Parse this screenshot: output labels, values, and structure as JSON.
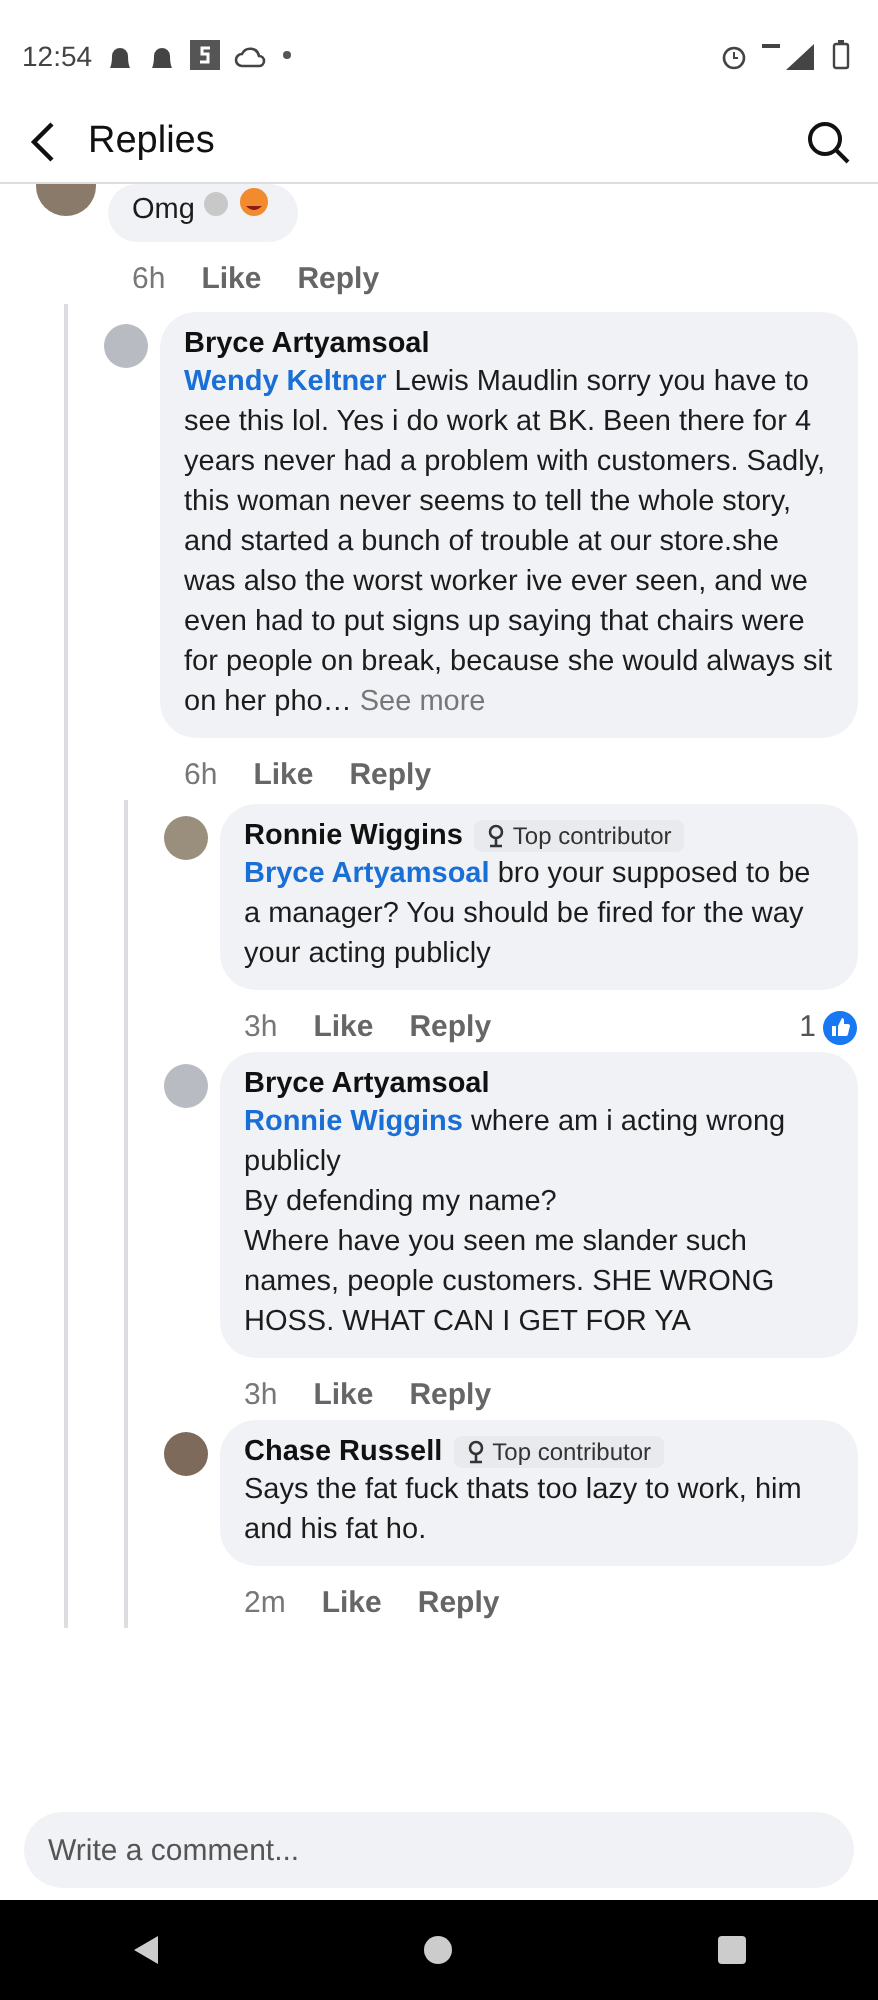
{
  "status_bar": {
    "time": "12:54"
  },
  "header": {
    "title": "Replies"
  },
  "comments": [
    {
      "text": "Omg",
      "emoji": true,
      "time": "6h",
      "actions": [
        "Like",
        "Reply"
      ],
      "children": [
        {
          "author": "Bryce Artyamsoal",
          "mention": "Wendy Keltner",
          "text": "Lewis Maudlin sorry you have to see this lol. Yes i do work at BK. Been there for 4 years never had a problem with customers. Sadly, this woman never seems to tell the whole story, and started a bunch of trouble at our store.she was also the worst worker ive ever seen, and we even had to put signs up saying that chairs were for people on break, because she would always sit on her pho…",
          "see_more": "See more",
          "time": "6h",
          "actions": [
            "Like",
            "Reply"
          ],
          "children": [
            {
              "author": "Ronnie Wiggins",
              "badge": "Top contributor",
              "mention": "Bryce Artyamsoal",
              "text": "bro your supposed to be a manager? You should be fired for the way your acting publicly",
              "time": "3h",
              "actions": [
                "Like",
                "Reply"
              ],
              "reactions": "1"
            },
            {
              "author": "Bryce Artyamsoal",
              "mention": "Ronnie Wiggins",
              "text": "where am i acting wrong publicly\nBy defending my name?\nWhere have you seen me slander such names, people customers.  SHE WRONG HOSS. WHAT CAN I GET FOR YA",
              "time": "3h",
              "actions": [
                "Like",
                "Reply"
              ]
            },
            {
              "author": "Chase Russell",
              "badge": "Top contributor",
              "text": "Says the fat fuck thats too lazy to work, him and his fat ho.",
              "time": "2m",
              "actions": [
                "Like",
                "Reply"
              ]
            }
          ]
        }
      ]
    }
  ],
  "composer": {
    "placeholder": "Write a comment..."
  }
}
